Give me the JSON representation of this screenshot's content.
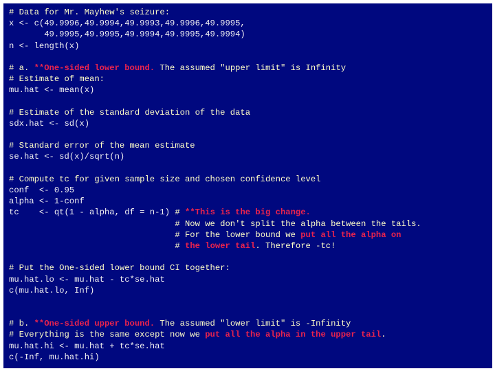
{
  "colors": {
    "background": "#00087f",
    "comment": "#ffffc8",
    "code": "#f2f2f2",
    "highlight": "#e8234e"
  },
  "lines": [
    {
      "segments": [
        {
          "t": "# Data for Mr. Mayhew's seizure:",
          "k": "cmt"
        }
      ]
    },
    {
      "segments": [
        {
          "t": "x <- c(49.9996,49.9994,49.9993,49.9996,49.9995,",
          "k": "src"
        }
      ]
    },
    {
      "segments": [
        {
          "t": "       49.9995,49.9995,49.9994,49.9995,49.9994)",
          "k": "src"
        }
      ]
    },
    {
      "segments": [
        {
          "t": "n <- length(x)",
          "k": "src"
        }
      ]
    },
    {
      "segments": []
    },
    {
      "segments": [
        {
          "t": "# a. ",
          "k": "cmt"
        },
        {
          "t": "**One-sided lower bound.",
          "k": "hl"
        },
        {
          "t": " The assumed \"upper limit\" is Infinity",
          "k": "cmt"
        }
      ]
    },
    {
      "segments": [
        {
          "t": "# Estimate of mean:",
          "k": "cmt"
        }
      ]
    },
    {
      "segments": [
        {
          "t": "mu.hat <- mean(x)",
          "k": "src"
        }
      ]
    },
    {
      "segments": []
    },
    {
      "segments": [
        {
          "t": "# Estimate of the standard deviation of the data",
          "k": "cmt"
        }
      ]
    },
    {
      "segments": [
        {
          "t": "sdx.hat <- sd(x)",
          "k": "src"
        }
      ]
    },
    {
      "segments": []
    },
    {
      "segments": [
        {
          "t": "# Standard error of the mean estimate",
          "k": "cmt"
        }
      ]
    },
    {
      "segments": [
        {
          "t": "se.hat <- sd(x)/sqrt(n)",
          "k": "src"
        }
      ]
    },
    {
      "segments": []
    },
    {
      "segments": [
        {
          "t": "# Compute tc for given sample size and chosen confidence level",
          "k": "cmt"
        }
      ]
    },
    {
      "segments": [
        {
          "t": "conf  <- 0.95",
          "k": "src"
        }
      ]
    },
    {
      "segments": [
        {
          "t": "alpha <- 1-conf",
          "k": "src"
        }
      ]
    },
    {
      "segments": [
        {
          "t": "tc    <- qt(1 - alpha, df = n-1) ",
          "k": "src"
        },
        {
          "t": "# ",
          "k": "cmt"
        },
        {
          "t": "**This is the big change.",
          "k": "hl"
        }
      ]
    },
    {
      "segments": [
        {
          "t": "                                 ",
          "k": "src"
        },
        {
          "t": "# Now we don't split the alpha between the tails.",
          "k": "cmt"
        }
      ]
    },
    {
      "segments": [
        {
          "t": "                                 ",
          "k": "src"
        },
        {
          "t": "# For the lower bound we ",
          "k": "cmt"
        },
        {
          "t": "put all the alpha on",
          "k": "hl"
        }
      ]
    },
    {
      "segments": [
        {
          "t": "                                 ",
          "k": "src"
        },
        {
          "t": "# ",
          "k": "cmt"
        },
        {
          "t": "the lower tail",
          "k": "hl"
        },
        {
          "t": ". Therefore -tc!",
          "k": "cmt"
        }
      ]
    },
    {
      "segments": []
    },
    {
      "segments": [
        {
          "t": "# Put the One-sided lower bound CI together:",
          "k": "cmt"
        }
      ]
    },
    {
      "segments": [
        {
          "t": "mu.hat.lo <- mu.hat - tc*se.hat",
          "k": "src"
        }
      ]
    },
    {
      "segments": [
        {
          "t": "c(mu.hat.lo, Inf)",
          "k": "src"
        }
      ]
    },
    {
      "segments": []
    },
    {
      "segments": []
    },
    {
      "segments": [
        {
          "t": "# b. ",
          "k": "cmt"
        },
        {
          "t": "**One-sided upper bound.",
          "k": "hl"
        },
        {
          "t": " The assumed \"lower limit\" is -Infinity",
          "k": "cmt"
        }
      ]
    },
    {
      "segments": [
        {
          "t": "# Everything is the same except now we ",
          "k": "cmt"
        },
        {
          "t": "put all the alpha in the upper tail",
          "k": "hl"
        },
        {
          "t": ".",
          "k": "cmt"
        }
      ]
    },
    {
      "segments": [
        {
          "t": "mu.hat.hi <- mu.hat + tc*se.hat",
          "k": "src"
        }
      ]
    },
    {
      "segments": [
        {
          "t": "c(-Inf, mu.hat.hi)",
          "k": "src"
        }
      ]
    }
  ]
}
